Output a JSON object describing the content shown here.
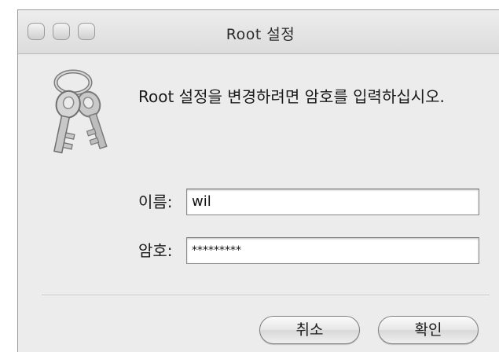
{
  "window": {
    "title": "Root 설정"
  },
  "dialog": {
    "message": "Root 설정을 변경하려면 암호를 입력하십시오.",
    "name_label": "이름:",
    "name_value": "wil",
    "password_label": "암호:",
    "password_value": "*********"
  },
  "buttons": {
    "cancel_label": "취소",
    "ok_label": "확인"
  },
  "icons": {
    "traffic_lights": [
      "close-icon",
      "minimize-icon",
      "zoom-icon"
    ],
    "app_icon": "keys-icon"
  }
}
